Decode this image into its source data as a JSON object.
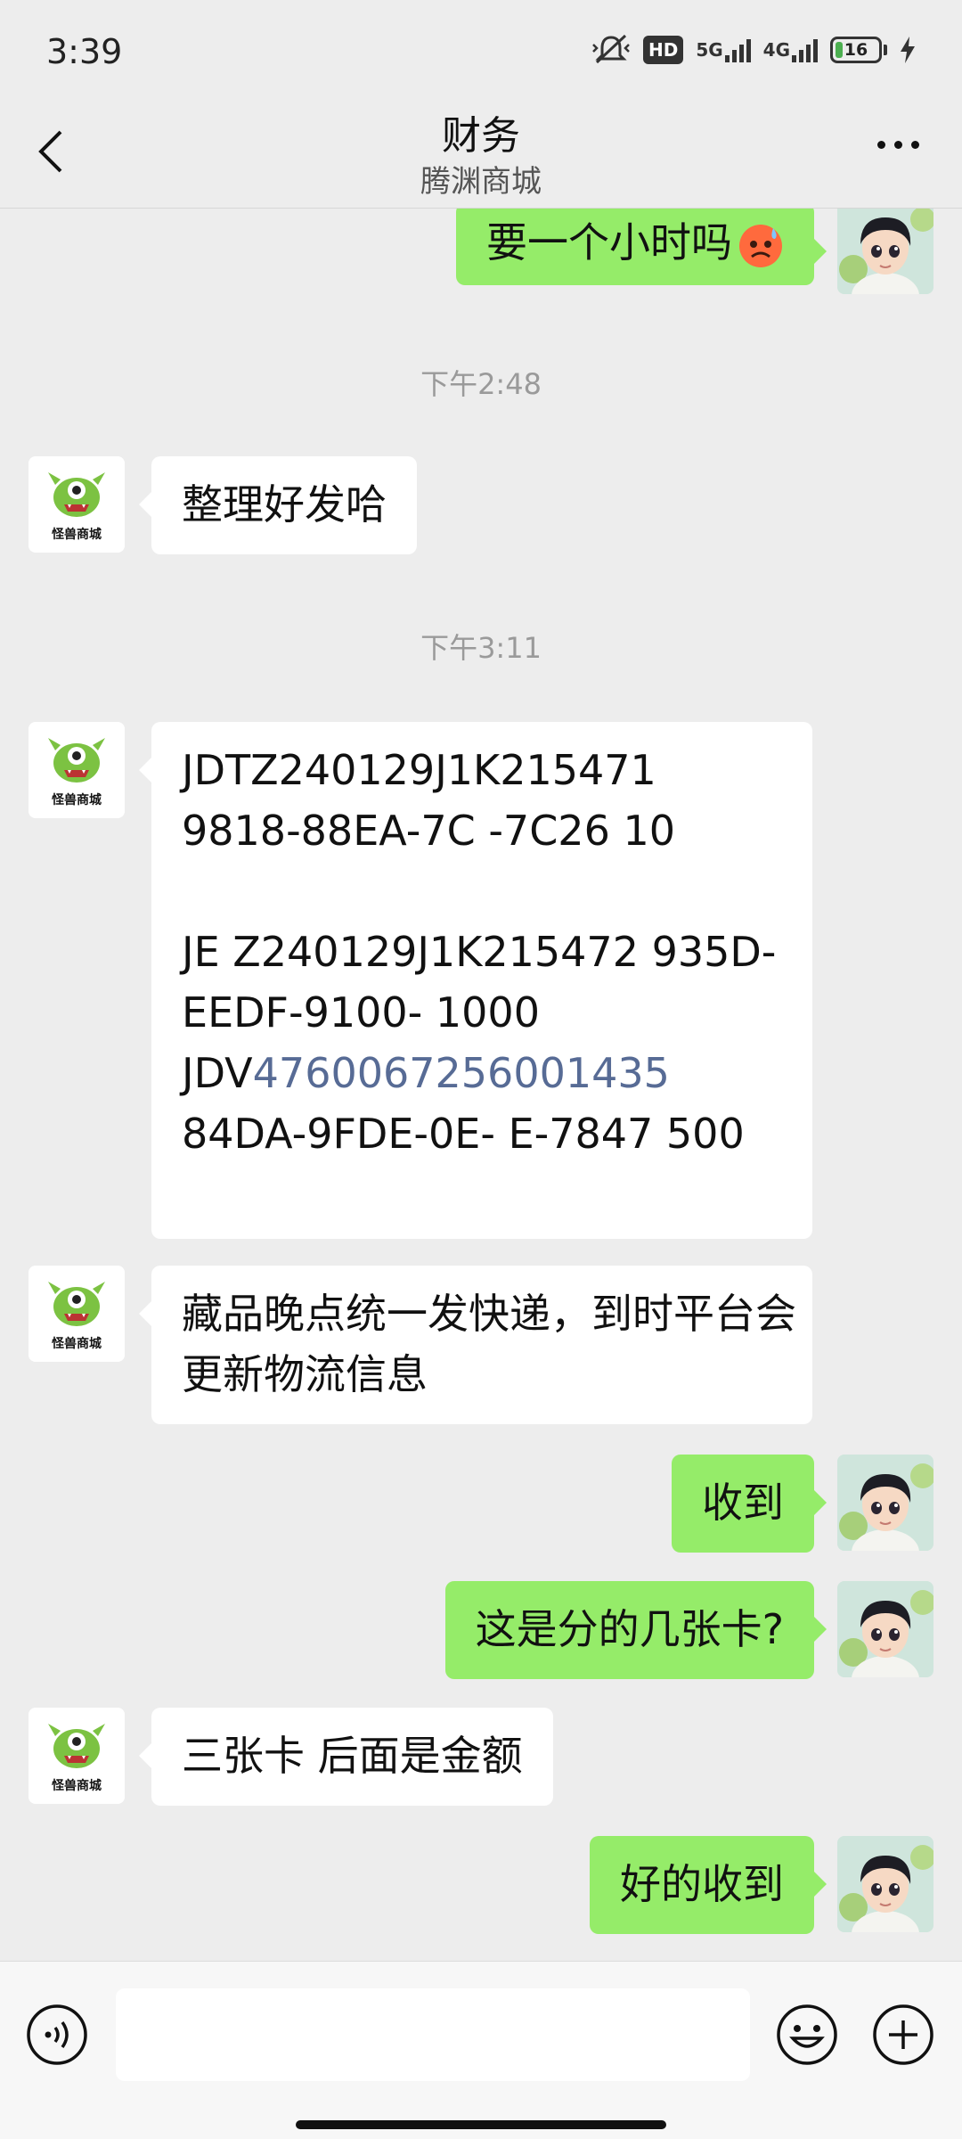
{
  "status_bar": {
    "time": "3:39",
    "hd_badge": "HD",
    "net_5g": "5G",
    "net_4g": "4G",
    "battery": "16"
  },
  "nav": {
    "title": "财务",
    "subtitle": "腾渊商城",
    "back_icon": "chevron-left-icon",
    "more_icon": "more-dots-icon"
  },
  "messages": [
    {
      "side": "right",
      "sender": "me",
      "text": "要一个小时吗",
      "emoji": "sweat-angry-emoji"
    },
    {
      "type": "timestamp",
      "text": "下午2:48"
    },
    {
      "side": "left",
      "sender": "腾渊商城",
      "text": "整理好发哈"
    },
    {
      "type": "timestamp",
      "text": "下午3:11"
    },
    {
      "side": "left",
      "sender": "腾渊商城",
      "lines": [
        "JDTZ240129J1K215471",
        "9818-88EA-7C   -7C26 10",
        "",
        "JE Z240129J1K215472 935D-",
        "EEDF-9100-          1000",
        "JDV",
        "84DA-9FDE-0E- E-7847 500"
      ],
      "link_prefix": "JDV",
      "link_text": "4760067256001435"
    },
    {
      "side": "left",
      "sender": "腾渊商城",
      "lines": [
        "藏品晚点统一发快递，到时平台会",
        "更新物流信息"
      ]
    },
    {
      "side": "right",
      "sender": "me",
      "text": "收到"
    },
    {
      "side": "right",
      "sender": "me",
      "text": "这是分的几张卡?"
    },
    {
      "side": "left",
      "sender": "腾渊商城",
      "text": "三张卡 后面是金额"
    },
    {
      "side": "right",
      "sender": "me",
      "text": "好的收到"
    }
  ],
  "avatars": {
    "left_label": "怪兽商城"
  },
  "input_bar": {
    "voice_icon": "voice-icon",
    "emoji_icon": "smile-icon",
    "plus_icon": "plus-icon"
  },
  "colors": {
    "background": "#ededed",
    "bubble_self": "#95ec69",
    "bubble_other": "#ffffff",
    "link": "#576b95"
  }
}
